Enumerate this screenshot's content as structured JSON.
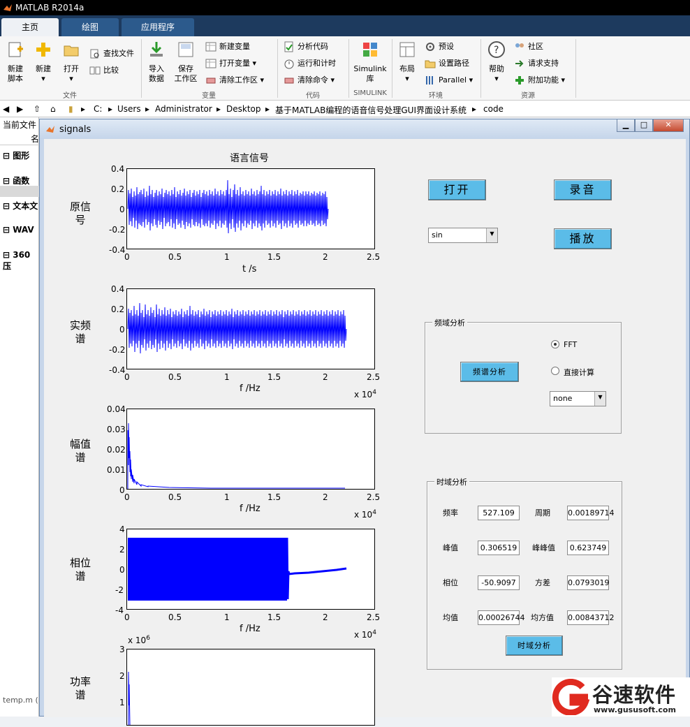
{
  "app": {
    "title": "MATLAB R2014a"
  },
  "tabs": [
    "主页",
    "绘图",
    "应用程序"
  ],
  "ribbon": {
    "new_script": "新建\n脚本",
    "new": "新建",
    "open": "打开",
    "find_files": "查找文件",
    "compare": "比较",
    "import": "导入\n数据",
    "save_ws": "保存\n工作区",
    "new_var": "新建变量",
    "open_var": "打开变量",
    "clear_ws": "清除工作区",
    "analyze": "分析代码",
    "run_time": "运行和计时",
    "clear_cmd": "清除命令",
    "simulink": "Simulink\n库",
    "layout": "布局",
    "prefs": "预设",
    "set_path": "设置路径",
    "parallel": "Parallel",
    "help": "帮助",
    "community": "社区",
    "support": "请求支持",
    "addons": "附加功能",
    "groups": [
      "文件",
      "变量",
      "代码",
      "SIMULINK",
      "环境",
      "资源"
    ]
  },
  "path": {
    "segments": [
      "C:",
      "Users",
      "Administrator",
      "Desktop",
      "基于MATLAB编程的语音信号处理GUI界面设计系统",
      "code"
    ]
  },
  "left_panel": {
    "header": "当前文件",
    "col": "名",
    "items": [
      "图形",
      "函数",
      "文本文",
      "WAV",
      "360压"
    ],
    "bottom": "temp.m ("
  },
  "window": {
    "title": "signals"
  },
  "plots": {
    "title": "语言信号",
    "labels": [
      "原信\n号",
      "实频\n谱",
      "幅值\n谱",
      "相位\n谱",
      "功率\n谱"
    ],
    "xlabels": [
      "t /s",
      "f /Hz",
      "f /Hz",
      "f /Hz"
    ],
    "xticks": [
      "0",
      "0.5",
      "1",
      "1.5",
      "2",
      "2.5"
    ],
    "xscale": "x 10",
    "xexp": "4",
    "y1": [
      "0.4",
      "0.2",
      "0",
      "-0.2",
      "-0.4"
    ],
    "y2": [
      "0.4",
      "0.2",
      "0",
      "-0.2",
      "-0.4"
    ],
    "y3": [
      "0.04",
      "0.03",
      "0.02",
      "0.01",
      "0"
    ],
    "y4": [
      "4",
      "2",
      "0",
      "-2",
      "-4"
    ],
    "y5": [
      "3",
      "2",
      "1"
    ],
    "y5scale": "x 10",
    "y5exp": "6"
  },
  "controls": {
    "open": "打开",
    "record": "录音",
    "play": "播放",
    "signal_select": "sin",
    "freq_panel": "频域分析",
    "spectrum_btn": "频谱分析",
    "fft": "FFT",
    "direct": "直接计算",
    "window_select": "none",
    "time_panel": "时域分析",
    "time_btn": "时域分析"
  },
  "time_stats": {
    "freq_label": "频率",
    "freq": "527.109",
    "period_label": "周期",
    "period": "0.00189714",
    "peak_label": "峰值",
    "peak": "0.306519",
    "p2p_label": "峰峰值",
    "p2p": "0.623749",
    "phase_label": "相位",
    "phase": "-50.9097",
    "var_label": "方差",
    "var": "0.0793019",
    "mean_label": "均值",
    "mean": "0.00026744",
    "ms_label": "均方值",
    "ms": "0.00843712"
  },
  "watermark": {
    "name": "谷速软件",
    "url": "www.gususoft.com"
  }
}
